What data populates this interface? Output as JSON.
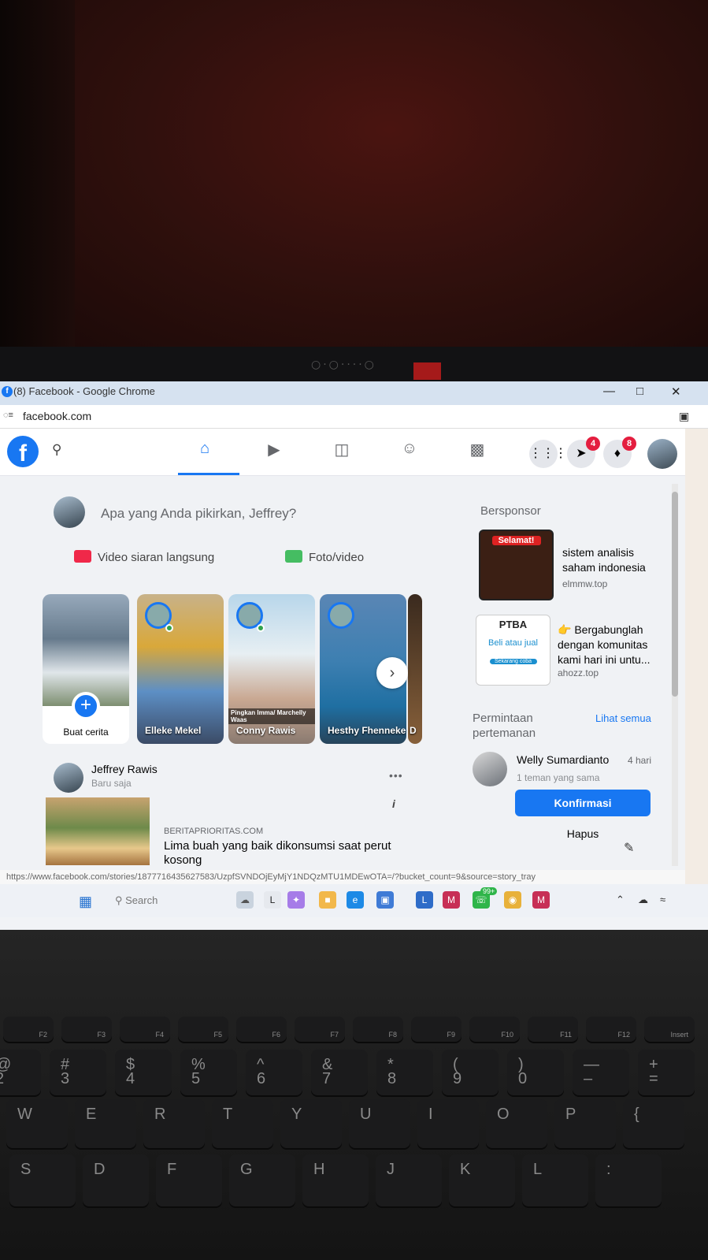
{
  "window": {
    "title": "(8) Facebook - Google Chrome",
    "url": "facebook.com",
    "status_url": "https://www.facebook.com/stories/1877716435627583/UzpfSVNDOjEyMjY1NDQzMTU1MDEwOTA=/?bucket_count=9&source=story_tray"
  },
  "nav": {
    "messenger_badge": "4",
    "notifications_badge": "8"
  },
  "composer": {
    "placeholder": "Apa yang Anda pikirkan, Jeffrey?",
    "live_label": "Video siaran langsung",
    "photo_label": "Foto/video"
  },
  "stories": {
    "create_label": "Buat cerita",
    "items": [
      {
        "name": "Elleke Mekel"
      },
      {
        "name": "Conny Rawis",
        "overlay": "Pingkan Imma/ Marchelly Waas"
      },
      {
        "name": "Hesthy Fhenneke"
      },
      {
        "name": "D"
      }
    ]
  },
  "post": {
    "author": "Jeffrey Rawis",
    "time": "Baru saja",
    "site": "BERITAPRIORITAS.COM",
    "title": "Lima buah yang baik dikonsumsi saat perut kosong"
  },
  "sidebar": {
    "sponsored": "Bersponsor",
    "ads": [
      {
        "title": "sistem analisis saham indonesia",
        "site": "elmmw.top",
        "img_text": "Selamat!"
      },
      {
        "title": "👉 Bergabunglah dengan komunitas kami hari ini untu...",
        "site": "ahozz.top",
        "img_text": "PTBA",
        "img_sub": "Beli atau jual",
        "img_btn": "Sekarang coba"
      }
    ],
    "friend_requests": "Permintaan pertemanan",
    "see_all": "Lihat semua",
    "request": {
      "name": "Welly Sumardianto",
      "time": "4 hari",
      "mutual": "1 teman yang sama",
      "confirm": "Konfirmasi",
      "delete": "Hapus"
    }
  },
  "taskbar": {
    "search": "Search",
    "whatsapp_badge": "99+"
  },
  "keyboard": {
    "fn_row": [
      "F2",
      "F3",
      "F4",
      "F5",
      "F6",
      "F7",
      "F8",
      "F9",
      "F10",
      "F11",
      "F12",
      "Insert"
    ],
    "num_row": [
      [
        "@",
        "2"
      ],
      [
        "#",
        "3"
      ],
      [
        "$",
        "4"
      ],
      [
        "%",
        "5"
      ],
      [
        "^",
        "6"
      ],
      [
        "&",
        "7"
      ],
      [
        "*",
        "8"
      ],
      [
        "(",
        "9"
      ],
      [
        ")",
        "0"
      ],
      [
        "—",
        "–"
      ],
      [
        "+",
        "="
      ]
    ],
    "top_row": [
      "W",
      "E",
      "R",
      "T",
      "Y",
      "U",
      "I",
      "O",
      "P",
      "{"
    ],
    "home_row": [
      "S",
      "D",
      "F",
      "G",
      "H",
      "J",
      "K",
      "L",
      ":"
    ]
  }
}
